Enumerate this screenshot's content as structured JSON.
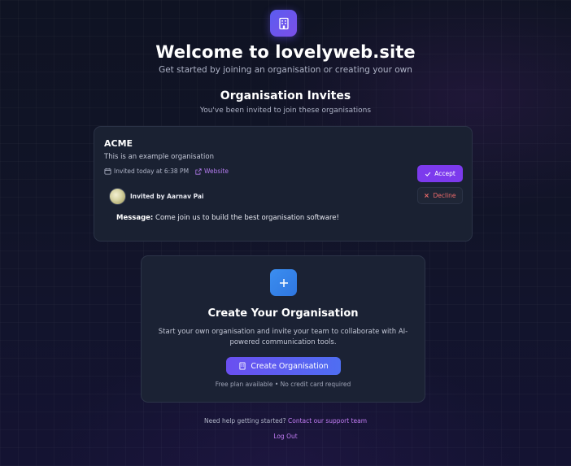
{
  "header": {
    "title": "Welcome to lovelyweb.site",
    "subtitle": "Get started by joining an organisation or creating your own",
    "logo_icon": "building-icon"
  },
  "invites": {
    "title": "Organisation Invites",
    "subtitle": "You've been invited to join these organisations",
    "items": [
      {
        "org_name": "ACME",
        "description": "This is an example organisation",
        "invited_time": "Invited today at 6:38 PM",
        "website_label": "Website",
        "invited_by": "Invited by Aarnav Pai",
        "message_label": "Message:",
        "message_text": "Come join us to build the best organisation software!",
        "accept_label": "Accept",
        "decline_label": "Decline"
      }
    ]
  },
  "create": {
    "title": "Create Your Organisation",
    "description": "Start your own organisation and invite your team to collaborate with AI-powered communication tools.",
    "button_label": "Create Organisation",
    "footnote": "Free plan available • No credit card required"
  },
  "footer": {
    "help_text": "Need help getting started?",
    "help_link": "Contact our support team",
    "logout_label": "Log Out"
  },
  "colors": {
    "accent_purple": "#7c3aed",
    "link_purple": "#c17cf3",
    "decline_red": "#ef6b6b",
    "create_blue": "#3b8ef0"
  }
}
